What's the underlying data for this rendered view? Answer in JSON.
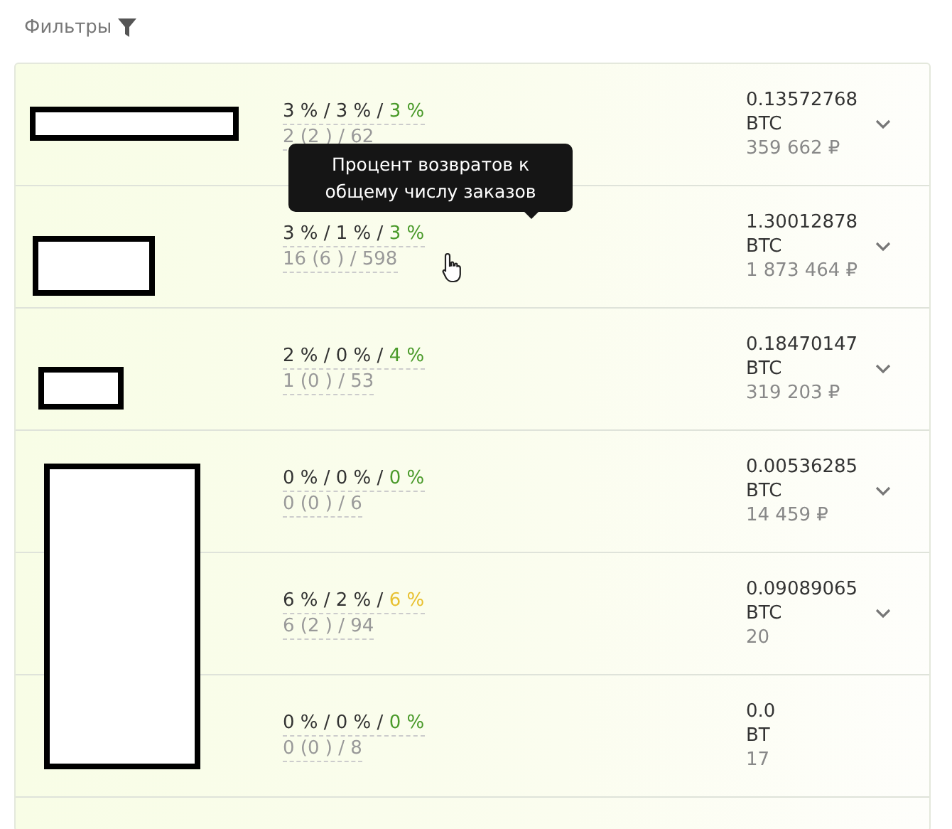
{
  "header": {
    "label": "Фильтры"
  },
  "rows": [
    {
      "rates": "3 % / 3 % /",
      "return_rate": "3 %",
      "color": "#4a9a2a",
      "counts": "2 (2 ) / 62",
      "amount": "0.13572768",
      "currency": "BTC",
      "fiat": "359 662 ₽",
      "chevron": true
    },
    {
      "rates": "3 % / 1 % /",
      "return_rate": "3 %",
      "color": "#4a9a2a",
      "counts": "16 (6 ) / 598",
      "amount": "1.30012878",
      "currency": "BTC",
      "fiat": "1 873 464 ₽",
      "chevron": true
    },
    {
      "rates": "2 % / 0 % /",
      "return_rate": "4 %",
      "color": "#4a9a2a",
      "counts": "1 (0 ) / 53",
      "amount": "0.18470147",
      "currency": "BTC",
      "fiat": "319 203 ₽",
      "chevron": true
    },
    {
      "rates": "0 % / 0 % /",
      "return_rate": "0 %",
      "color": "#4a9a2a",
      "counts": "0 (0 ) / 6",
      "amount": "0.00536285",
      "currency": "BTC",
      "fiat": "14 459 ₽",
      "chevron": true
    },
    {
      "rates": "6 % / 2 % /",
      "return_rate": "6 %",
      "color": "#e8c030",
      "counts": "6 (2 ) / 94",
      "amount": "0.09089065",
      "currency": "BTC",
      "fiat": "20",
      "chevron": true
    },
    {
      "rates": "0 % / 0 % /",
      "return_rate": "0 %",
      "color": "#4a9a2a",
      "counts": "0 (0 ) / 8",
      "amount": "0.0",
      "currency": "BT",
      "fiat": "17",
      "chevron": false
    }
  ],
  "tooltip": {
    "text": "Процент возвратов к общему числу заказов"
  }
}
